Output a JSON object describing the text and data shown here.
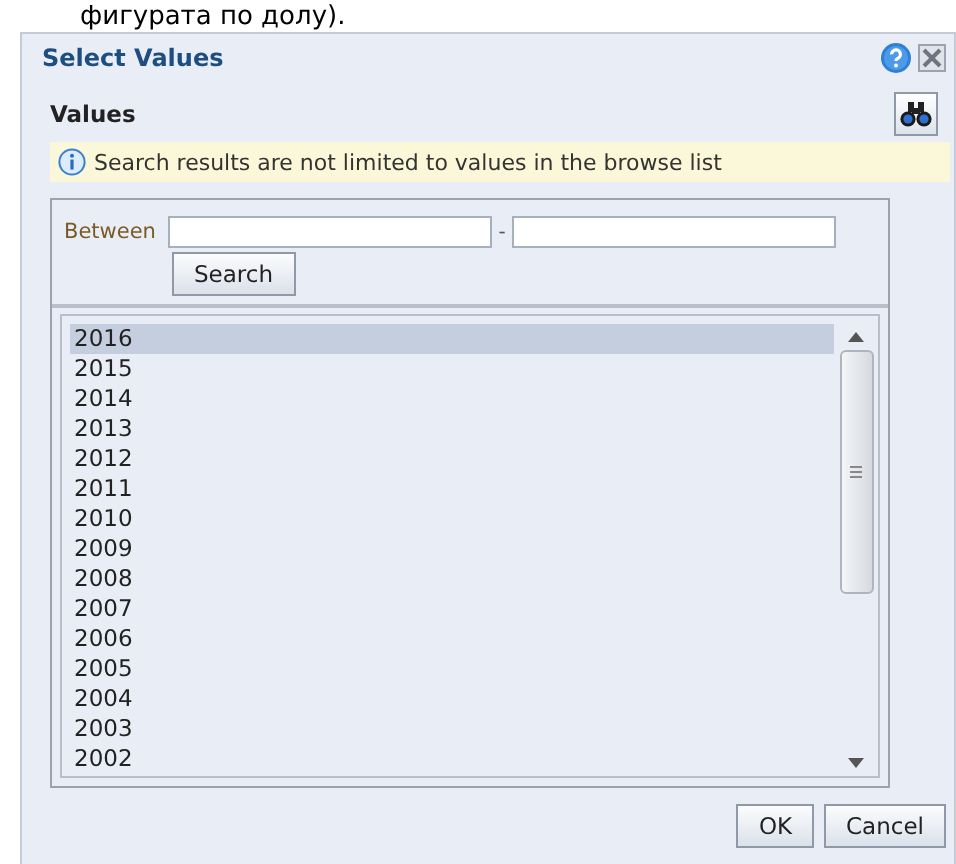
{
  "page_text": "фигурата по долу).",
  "dialog": {
    "title": "Select Values",
    "section_title": "Values",
    "info": "Search results are not limited to values in the browse list",
    "search": {
      "label": "Between",
      "separator": "-",
      "button": "Search"
    },
    "values": [
      {
        "label": "2016",
        "selected": true
      },
      {
        "label": "2015",
        "selected": false
      },
      {
        "label": "2014",
        "selected": false
      },
      {
        "label": "2013",
        "selected": false
      },
      {
        "label": "2012",
        "selected": false
      },
      {
        "label": "2011",
        "selected": false
      },
      {
        "label": "2010",
        "selected": false
      },
      {
        "label": "2009",
        "selected": false
      },
      {
        "label": "2008",
        "selected": false
      },
      {
        "label": "2007",
        "selected": false
      },
      {
        "label": "2006",
        "selected": false
      },
      {
        "label": "2005",
        "selected": false
      },
      {
        "label": "2004",
        "selected": false
      },
      {
        "label": "2003",
        "selected": false
      },
      {
        "label": "2002",
        "selected": false
      }
    ],
    "buttons": [
      "OK",
      "Cancel"
    ]
  }
}
